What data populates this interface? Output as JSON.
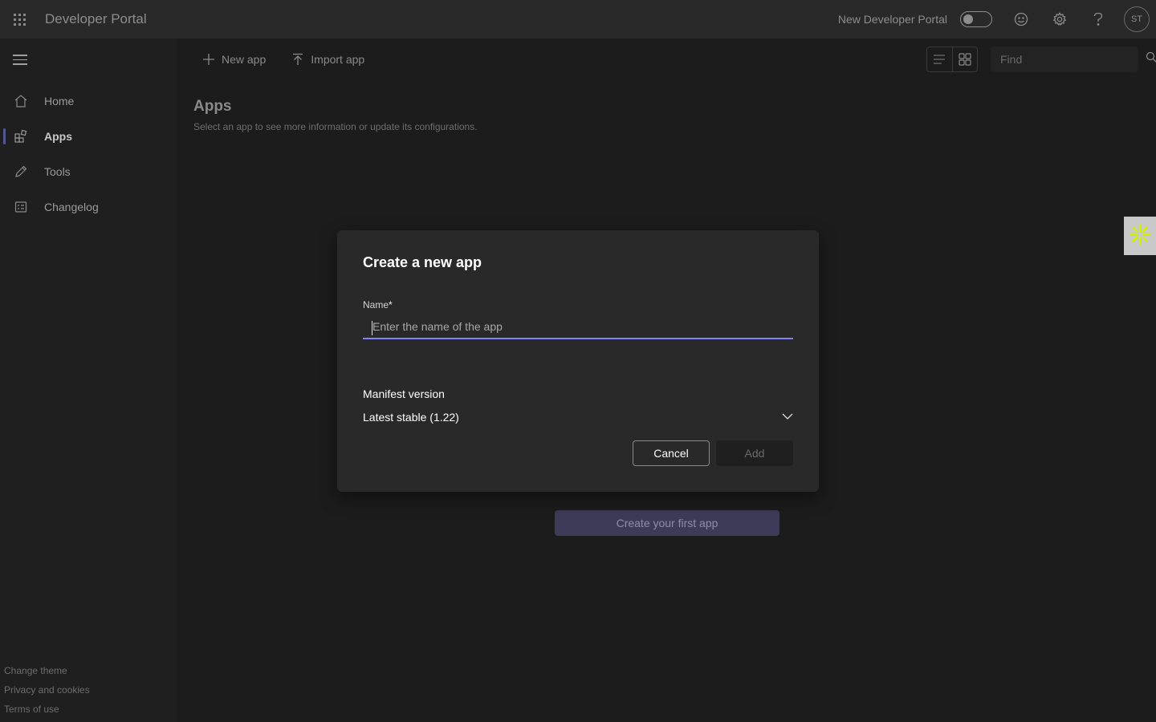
{
  "topbar": {
    "app_title": "Developer Portal",
    "new_portal_label": "New Developer Portal",
    "new_portal_toggle_on": false,
    "avatar_initials": "ST",
    "icons": [
      "app-launcher-icon",
      "feedback-icon",
      "settings-icon",
      "help-icon"
    ]
  },
  "sidebar": {
    "items": [
      {
        "label": "Home",
        "icon": "home-icon",
        "active": false
      },
      {
        "label": "Apps",
        "icon": "apps-icon",
        "active": true
      },
      {
        "label": "Tools",
        "icon": "tools-icon",
        "active": false
      },
      {
        "label": "Changelog",
        "icon": "changelog-icon",
        "active": false
      }
    ],
    "footer": [
      "Change theme",
      "Privacy and cookies",
      "Terms of use"
    ]
  },
  "commandbar": {
    "new_app_label": "New app",
    "import_app_label": "Import app",
    "find_placeholder": "Find"
  },
  "page": {
    "title": "Apps",
    "subtitle": "Select an app to see more information or update its configurations.",
    "create_first_label": "Create your first app"
  },
  "dialog": {
    "title": "Create a new app",
    "name_label": "Name",
    "name_required_marker": "*",
    "name_value": "",
    "name_placeholder": "Enter the name of the app",
    "manifest_label": "Manifest version",
    "manifest_value": "Latest stable (1.22)",
    "cancel_label": "Cancel",
    "add_label": "Add",
    "add_disabled": true
  },
  "colors": {
    "accent": "#7f85f5",
    "widget_icon": "#d4f000"
  }
}
